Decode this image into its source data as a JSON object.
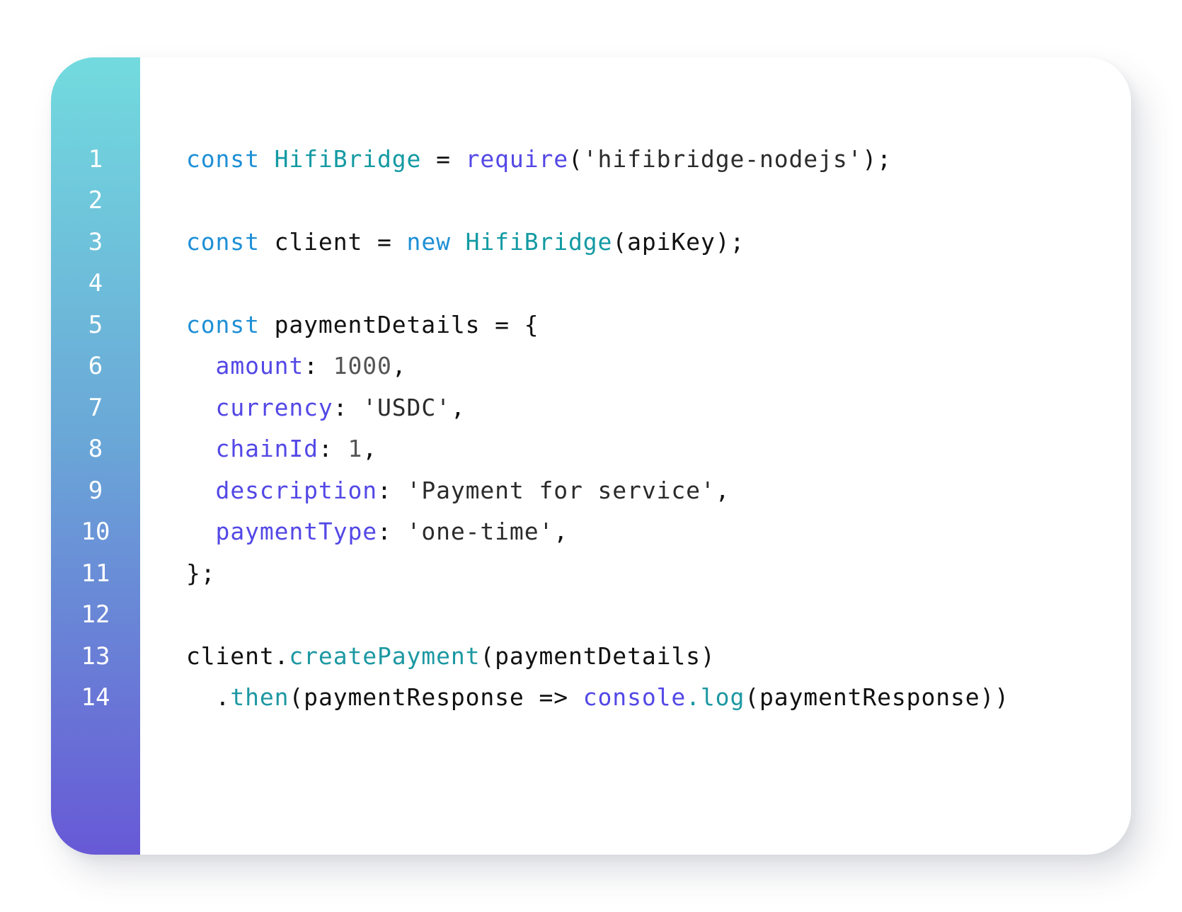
{
  "editor": {
    "theme": {
      "gutter_gradient": [
        "#72dbde",
        "#6aa7d7",
        "#6859d6"
      ],
      "keyword": "#1e8fd6",
      "class": "#139aa3",
      "builtin": "#5348e6",
      "property": "#5348e6",
      "function": "#1c98a2",
      "text": "#111111"
    },
    "lines": [
      {
        "number": "1",
        "tokens": [
          {
            "type": "keyword",
            "text": "const"
          },
          {
            "type": "punct",
            "text": " "
          },
          {
            "type": "class",
            "text": "HifiBridge"
          },
          {
            "type": "punct",
            "text": " = "
          },
          {
            "type": "builtin",
            "text": "require"
          },
          {
            "type": "punct",
            "text": "("
          },
          {
            "type": "string",
            "text": "'hifibridge-nodejs'"
          },
          {
            "type": "punct",
            "text": ");"
          }
        ]
      },
      {
        "number": "2",
        "tokens": []
      },
      {
        "number": "3",
        "tokens": [
          {
            "type": "keyword",
            "text": "const"
          },
          {
            "type": "punct",
            "text": " "
          },
          {
            "type": "ident",
            "text": "client"
          },
          {
            "type": "punct",
            "text": " = "
          },
          {
            "type": "keyword",
            "text": "new"
          },
          {
            "type": "punct",
            "text": " "
          },
          {
            "type": "class",
            "text": "HifiBridge"
          },
          {
            "type": "punct",
            "text": "("
          },
          {
            "type": "ident",
            "text": "apiKey"
          },
          {
            "type": "punct",
            "text": ");"
          }
        ]
      },
      {
        "number": "4",
        "tokens": []
      },
      {
        "number": "5",
        "tokens": [
          {
            "type": "keyword",
            "text": "const"
          },
          {
            "type": "punct",
            "text": " "
          },
          {
            "type": "ident",
            "text": "paymentDetails"
          },
          {
            "type": "punct",
            "text": " = {"
          }
        ]
      },
      {
        "number": "6",
        "tokens": [
          {
            "type": "punct",
            "text": "  "
          },
          {
            "type": "prop",
            "text": "amount"
          },
          {
            "type": "punct",
            "text": ": "
          },
          {
            "type": "number",
            "text": "1000"
          },
          {
            "type": "punct",
            "text": ","
          }
        ]
      },
      {
        "number": "7",
        "tokens": [
          {
            "type": "punct",
            "text": "  "
          },
          {
            "type": "prop",
            "text": "currency"
          },
          {
            "type": "punct",
            "text": ": "
          },
          {
            "type": "string",
            "text": "'USDC'"
          },
          {
            "type": "punct",
            "text": ","
          }
        ]
      },
      {
        "number": "8",
        "tokens": [
          {
            "type": "punct",
            "text": "  "
          },
          {
            "type": "prop",
            "text": "chainId"
          },
          {
            "type": "punct",
            "text": ": "
          },
          {
            "type": "number",
            "text": "1"
          },
          {
            "type": "punct",
            "text": ","
          }
        ]
      },
      {
        "number": "9",
        "tokens": [
          {
            "type": "punct",
            "text": "  "
          },
          {
            "type": "prop",
            "text": "description"
          },
          {
            "type": "punct",
            "text": ": "
          },
          {
            "type": "string",
            "text": "'Payment for service'"
          },
          {
            "type": "punct",
            "text": ","
          }
        ]
      },
      {
        "number": "10",
        "tokens": [
          {
            "type": "punct",
            "text": "  "
          },
          {
            "type": "prop",
            "text": "paymentType"
          },
          {
            "type": "punct",
            "text": ": "
          },
          {
            "type": "string",
            "text": "'one-time'"
          },
          {
            "type": "punct",
            "text": ","
          }
        ]
      },
      {
        "number": "11",
        "tokens": [
          {
            "type": "punct",
            "text": "};"
          }
        ]
      },
      {
        "number": "12",
        "tokens": []
      },
      {
        "number": "13",
        "tokens": [
          {
            "type": "ident",
            "text": "client"
          },
          {
            "type": "punct",
            "text": "."
          },
          {
            "type": "func",
            "text": "createPayment"
          },
          {
            "type": "punct",
            "text": "("
          },
          {
            "type": "ident",
            "text": "paymentDetails"
          },
          {
            "type": "punct",
            "text": ")"
          }
        ]
      },
      {
        "number": "14",
        "tokens": [
          {
            "type": "punct",
            "text": "  ."
          },
          {
            "type": "func",
            "text": "then"
          },
          {
            "type": "punct",
            "text": "("
          },
          {
            "type": "ident",
            "text": "paymentResponse"
          },
          {
            "type": "punct",
            "text": " => "
          },
          {
            "type": "builtin",
            "text": "console"
          },
          {
            "type": "func",
            "text": ".log"
          },
          {
            "type": "punct",
            "text": "("
          },
          {
            "type": "ident",
            "text": "paymentResponse"
          },
          {
            "type": "punct",
            "text": "))"
          }
        ]
      }
    ]
  }
}
